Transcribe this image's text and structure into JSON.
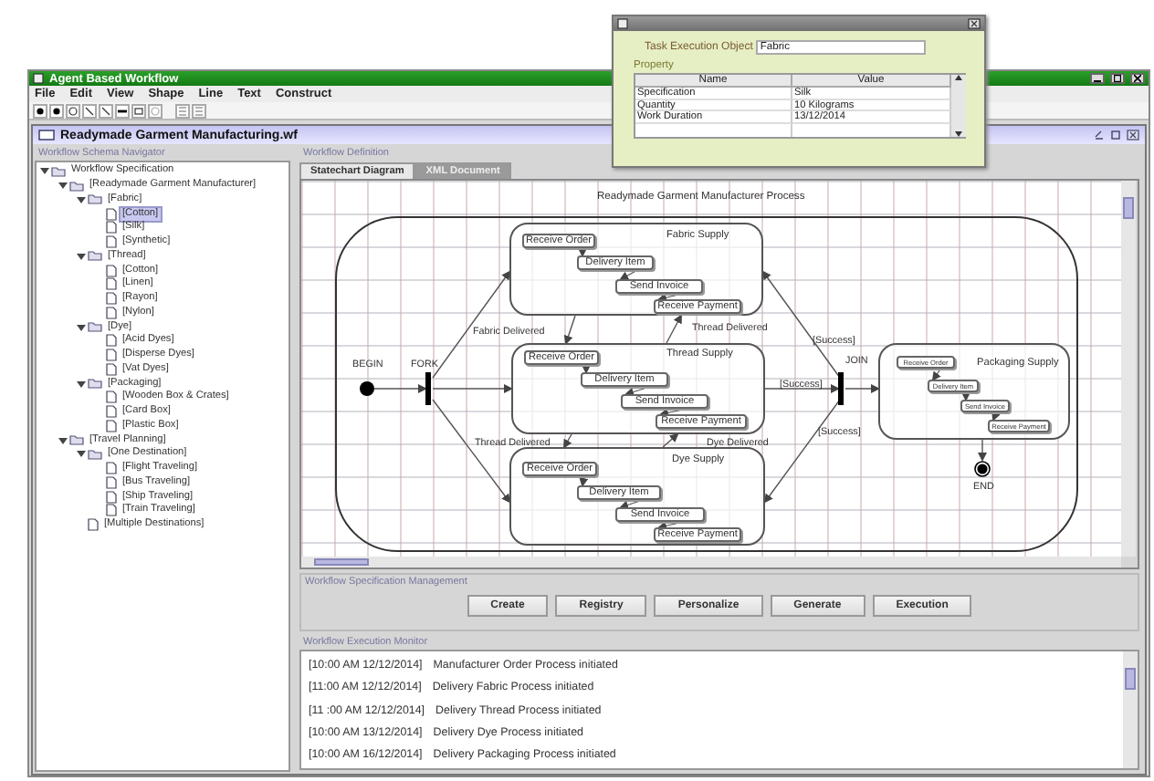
{
  "dialog": {
    "field_label": "Task Execution Object",
    "field_value": "Fabric",
    "section": "Property",
    "columns": [
      "Name",
      "Value"
    ],
    "rows": [
      {
        "name": "Specification",
        "value": "Silk"
      },
      {
        "name": "Quantity",
        "value": "10 Kilograms"
      },
      {
        "name": "Work Duration",
        "value": "13/12/2014"
      }
    ]
  },
  "window": {
    "title": "Agent Based Workflow"
  },
  "menu": [
    "File",
    "Edit",
    "View",
    "Shape",
    "Line",
    "Text",
    "Construct"
  ],
  "document": {
    "title": "Readymade Garment Manufacturing.wf"
  },
  "navigator": {
    "title": "Workflow Schema Navigator",
    "tree": [
      {
        "label": "Workflow Specification",
        "expanded": true,
        "selected": false,
        "children": [
          {
            "label": "[Readymade Garment Manufacturer]",
            "expanded": true,
            "selected": false,
            "children": [
              {
                "label": "[Fabric]",
                "expanded": true,
                "selected": false,
                "children": [
                  {
                    "label": "[Cotton]",
                    "selected": true
                  },
                  {
                    "label": "[Silk]",
                    "selected": false
                  },
                  {
                    "label": "[Synthetic]",
                    "selected": false
                  }
                ]
              },
              {
                "label": "[Thread]",
                "expanded": true,
                "selected": false,
                "children": [
                  {
                    "label": "[Cotton]",
                    "selected": false
                  },
                  {
                    "label": "[Linen]",
                    "selected": false
                  },
                  {
                    "label": "[Rayon]",
                    "selected": false
                  },
                  {
                    "label": "[Nylon]",
                    "selected": false
                  }
                ]
              },
              {
                "label": "[Dye]",
                "expanded": true,
                "selected": false,
                "children": [
                  {
                    "label": "[Acid Dyes]",
                    "selected": false
                  },
                  {
                    "label": "[Disperse Dyes]",
                    "selected": false
                  },
                  {
                    "label": "[Vat Dyes]",
                    "selected": false
                  }
                ]
              },
              {
                "label": "[Packaging]",
                "expanded": true,
                "selected": false,
                "children": [
                  {
                    "label": "[Wooden Box & Crates]",
                    "selected": false
                  },
                  {
                    "label": "[Card Box]",
                    "selected": false
                  },
                  {
                    "label": "[Plastic Box]",
                    "selected": false
                  }
                ]
              }
            ]
          },
          {
            "label": "[Travel Planning]",
            "expanded": true,
            "selected": false,
            "children": [
              {
                "label": "[One Destination]",
                "expanded": true,
                "selected": false,
                "children": [
                  {
                    "label": "[Flight Traveling]",
                    "selected": false
                  },
                  {
                    "label": "[Bus Traveling]",
                    "selected": false
                  },
                  {
                    "label": "[Ship Traveling]",
                    "selected": false
                  },
                  {
                    "label": "[Train Traveling]",
                    "selected": false
                  }
                ]
              },
              {
                "label": "[Multiple Destinations]",
                "selected": false
              }
            ]
          }
        ]
      }
    ]
  },
  "definition": {
    "title": "Workflow Definition",
    "tabs": [
      {
        "label": "Statechart Diagram",
        "selected": true
      },
      {
        "label": "XML Document",
        "selected": false
      }
    ],
    "diagram": {
      "title": "Readymade Garment Manufacturer Process",
      "nodes": [
        {
          "kind": "initial",
          "label": "BEGIN"
        },
        {
          "kind": "fork",
          "label": "FORK"
        },
        {
          "kind": "join",
          "label": "JOIN"
        },
        {
          "kind": "final",
          "label": "END"
        }
      ],
      "composites": [
        {
          "label": "Fabric Supply",
          "tasks": [
            "Receive Order",
            "Delivery Item",
            "Send Invoice",
            "Receive Payment"
          ]
        },
        {
          "label": "Thread Supply",
          "tasks": [
            "Receive Order",
            "Delivery Item",
            "Send Invoice",
            "Receive Payment"
          ]
        },
        {
          "label": "Dye Supply",
          "tasks": [
            "Receive Order",
            "Delivery Item",
            "Send Invoice",
            "Receive Payment"
          ]
        },
        {
          "label": "Packaging Supply",
          "tasks": [
            "Receive Order",
            "Delivery Item",
            "Send Invoice",
            "Receive Payment"
          ]
        }
      ],
      "transition_labels": [
        "Fabric Delivered",
        "Thread Delivered",
        "[Success]",
        "[Success]",
        "Thread Delivered",
        "Dye Delivered",
        "[Success]"
      ]
    }
  },
  "management": {
    "title": "Workflow Specification Management",
    "buttons": [
      "Create",
      "Registry",
      "Personalize",
      "Generate",
      "Execution"
    ]
  },
  "monitor": {
    "title": "Workflow Execution Monitor",
    "entries": [
      {
        "time": "[10:00 AM 12/12/2014]",
        "message": "Manufacturer Order Process initiated"
      },
      {
        "time": "[11:00 AM 12/12/2014]",
        "message": "Delivery Fabric Process initiated"
      },
      {
        "time": "[11 :00 AM 12/12/2014]",
        "message": "Delivery Thread Process initiated"
      },
      {
        "time": "[10:00 AM 13/12/2014]",
        "message": "Delivery Dye Process initiated"
      },
      {
        "time": "[10:00 AM 16/12/2014]",
        "message": "Delivery Packaging Process initiated"
      }
    ]
  }
}
